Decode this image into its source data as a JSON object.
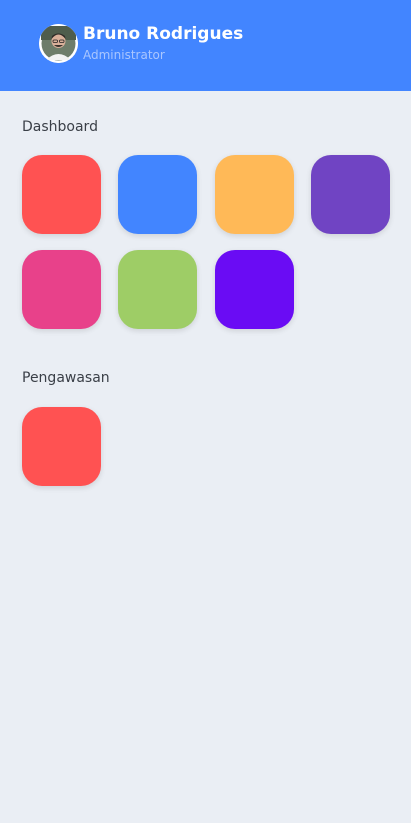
{
  "header": {
    "name": "Bruno Rodrigues",
    "role": "Administrator",
    "background": "#4285FF"
  },
  "sections": [
    {
      "title": "Dashboard",
      "tiles": [
        {
          "color": "#FF5252"
        },
        {
          "color": "#4285FF"
        },
        {
          "color": "#FFB957"
        },
        {
          "color": "#7044C3"
        },
        {
          "color": "#E8418A"
        },
        {
          "color": "#9ECD66"
        },
        {
          "color": "#6A0CF4"
        }
      ]
    },
    {
      "title": "Pengawasan",
      "tiles": [
        {
          "color": "#FF5252"
        }
      ]
    }
  ]
}
